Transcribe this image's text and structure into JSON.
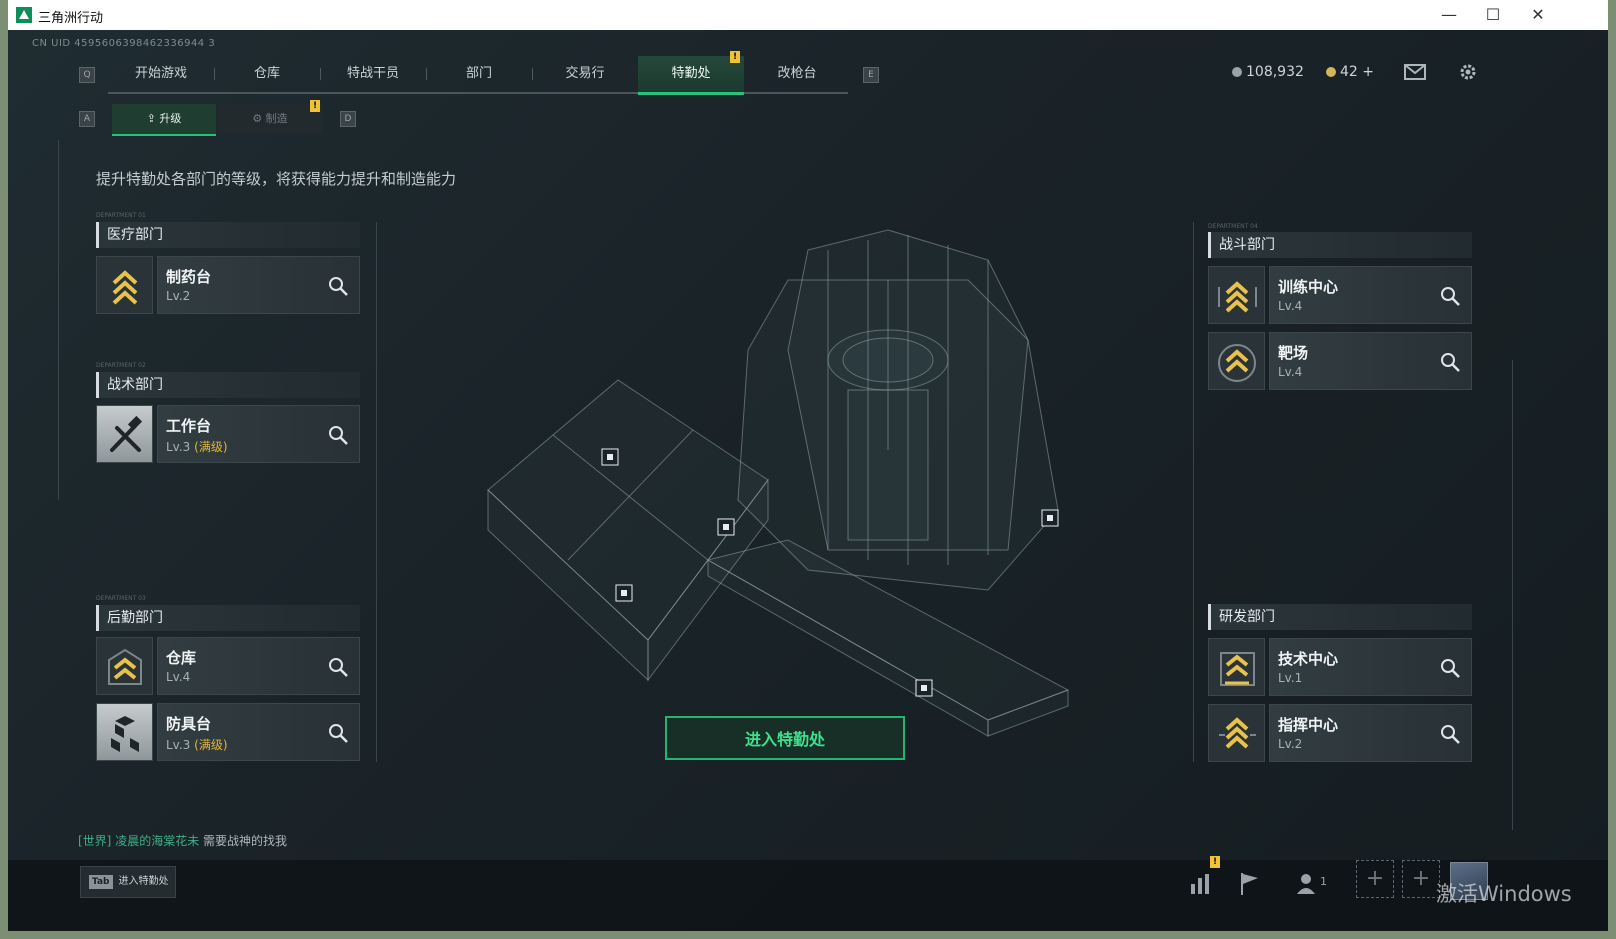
{
  "window": {
    "title": "三角洲行动",
    "controls": [
      "—",
      "☐",
      "✕"
    ]
  },
  "uid": "CN UID 4595606398462336944 3",
  "key_hints": {
    "left": "Q",
    "right": "E",
    "sub_left": "A",
    "sub_right": "D"
  },
  "tabs": [
    "开始游戏",
    "仓库",
    "特战干员",
    "部门",
    "交易行",
    "特勤处",
    "改枪台"
  ],
  "active_tab": "特勤处",
  "currency": {
    "coins": "108,932",
    "tokens": "42",
    "plus": "+"
  },
  "subtabs": {
    "upgrade": "升级",
    "craft": "制造"
  },
  "description": "提升特勤处各部门的等级，将获得能力提升和制造能力",
  "departments": {
    "medical": {
      "name": "医疗部门",
      "items": [
        {
          "name": "制药台",
          "level": "Lv.2"
        }
      ]
    },
    "tactical": {
      "name": "战术部门",
      "items": [
        {
          "name": "工作台",
          "level": "Lv.3",
          "max": "(满级)"
        }
      ]
    },
    "logistics": {
      "name": "后勤部门",
      "items": [
        {
          "name": "仓库",
          "level": "Lv.4"
        },
        {
          "name": "防具台",
          "level": "Lv.3",
          "max": "(满级)"
        }
      ]
    },
    "combat": {
      "name": "战斗部门",
      "items": [
        {
          "name": "训练中心",
          "level": "Lv.4"
        },
        {
          "name": "靶场",
          "level": "Lv.4"
        }
      ]
    },
    "research": {
      "name": "研发部门",
      "items": [
        {
          "name": "技术中心",
          "level": "Lv.1"
        },
        {
          "name": "指挥中心",
          "level": "Lv.2"
        }
      ]
    }
  },
  "enter_button": "进入特勤处",
  "chat": {
    "channel": "[世界]",
    "user": "凌晨的海棠花未",
    "message": "需要战神的找我"
  },
  "tab_hint": {
    "key": "Tab",
    "label": "进入特勤处"
  },
  "bottom": {
    "friends_count": "1"
  },
  "watermark": "激活Windows",
  "colors": {
    "accent": "#27c27a",
    "warning": "#f0c237",
    "max_level": "#e2b53a",
    "background": "#1a2328"
  },
  "icons": [
    "chevron-rank-icon",
    "tools-icon",
    "cubes-icon",
    "magnify-icon",
    "mail-icon",
    "gear-icon",
    "stats-icon",
    "flag-icon",
    "friends-icon"
  ]
}
